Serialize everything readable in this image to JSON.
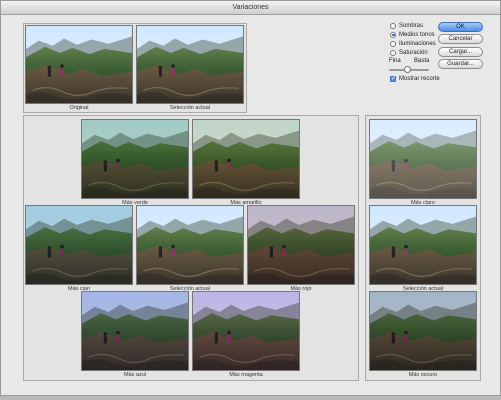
{
  "window": {
    "title": "Variaciones"
  },
  "top_previews": [
    {
      "label": "Original"
    },
    {
      "label": "Selección actual"
    }
  ],
  "options": {
    "radios": [
      {
        "label": "Sombras",
        "selected": false
      },
      {
        "label": "Medios tonos",
        "selected": true
      },
      {
        "label": "Iluminaciones",
        "selected": false
      },
      {
        "label": "Saturación",
        "selected": false
      }
    ],
    "slider": {
      "min_label": "Fina",
      "max_label": "Basta",
      "value": 0.45
    },
    "show_clipping": {
      "label": "Mostrar recorte",
      "checked": true
    }
  },
  "buttons": {
    "ok": "OK",
    "cancel": "Cancelar",
    "load": "Cargar...",
    "save": "Guardar..."
  },
  "color_variations": [
    {
      "label": "Más verde",
      "tint": "#2f8a2f"
    },
    {
      "label": "Más amarillo",
      "tint": "#b9b23a"
    },
    {
      "label": "Más cian",
      "tint": "#2f8f8f"
    },
    {
      "label": "Selección actual",
      "tint": "#000000"
    },
    {
      "label": "Más rojo",
      "tint": "#a23a3a"
    },
    {
      "label": "Más azul",
      "tint": "#3a3aa2"
    },
    {
      "label": "Más magenta",
      "tint": "#a23aa2"
    }
  ],
  "brightness_variations": [
    {
      "label": "Más claro"
    },
    {
      "label": "Selección actual"
    },
    {
      "label": "Más oscuro"
    }
  ]
}
